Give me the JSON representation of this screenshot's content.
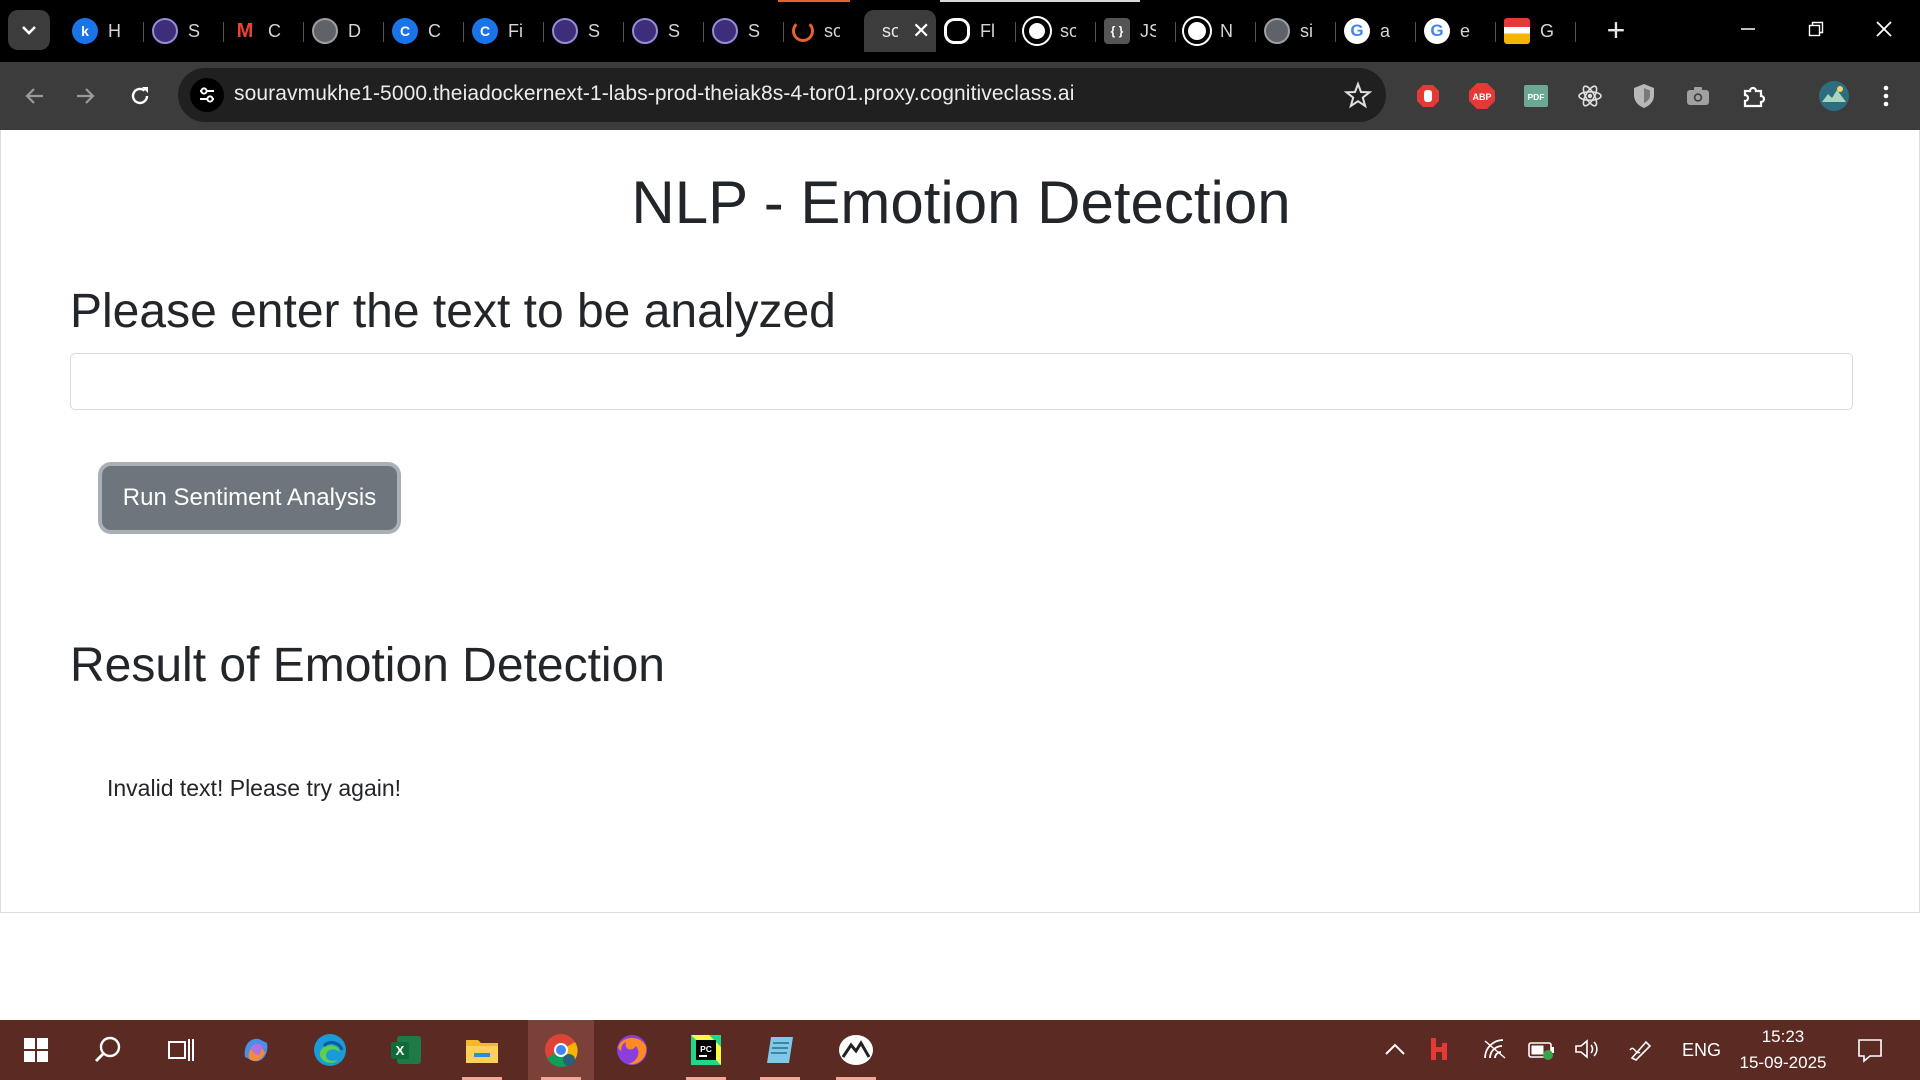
{
  "browser": {
    "tabs": [
      {
        "label": "H",
        "icon": "kaggle-icon",
        "color": "#1a73e8"
      },
      {
        "label": "S",
        "icon": "coursera-icon",
        "color": "#3d2d7a"
      },
      {
        "label": "C",
        "icon": "gmail-icon",
        "color": "#ea4335"
      },
      {
        "label": "D",
        "icon": "globe-icon",
        "color": "#5f6368"
      },
      {
        "label": "C",
        "icon": "c-icon",
        "color": "#1a73e8"
      },
      {
        "label": "Fi",
        "icon": "c-icon",
        "color": "#1a73e8"
      },
      {
        "label": "S",
        "icon": "coursera-icon",
        "color": "#3d2d7a"
      },
      {
        "label": "S",
        "icon": "coursera-icon",
        "color": "#3d2d7a"
      },
      {
        "label": "S",
        "icon": "coursera-icon",
        "color": "#3d2d7a"
      },
      {
        "label": "so",
        "icon": "loading-icon",
        "color": "#e8602c"
      },
      {
        "label": "so",
        "icon": "active-tab",
        "color": "#3c3c3c",
        "active": true
      },
      {
        "label": "Fl",
        "icon": "openai-icon",
        "color": "#ffffff"
      },
      {
        "label": "so",
        "icon": "github-icon",
        "color": "#ffffff"
      },
      {
        "label": "JS",
        "icon": "json-icon",
        "color": "#555555"
      },
      {
        "label": "N",
        "icon": "chrome-icon",
        "color": "#ffffff"
      },
      {
        "label": "si",
        "icon": "globe-icon",
        "color": "#5f6368"
      },
      {
        "label": "a",
        "icon": "google-icon",
        "color": "#ffffff"
      },
      {
        "label": "e",
        "icon": "google-icon",
        "color": "#ffffff"
      },
      {
        "label": "G",
        "icon": "gallery-icon",
        "color": "#e53935"
      }
    ],
    "url": "souravmukhe1-5000.theiadockernext-1-labs-prod-theiak8s-4-tor01.proxy.cognitiveclass.ai",
    "extensions": [
      "stop-hand-icon",
      "adblock-icon",
      "pdf-icon",
      "react-icon",
      "shield-icon",
      "camera-icon",
      "puzzle-icon",
      "profile-avatar"
    ]
  },
  "page": {
    "title": "NLP - Emotion Detection",
    "prompt": "Please enter the text to be analyzed",
    "input_value": "",
    "button_label": "Run Sentiment Analysis",
    "result_heading": "Result of Emotion Detection",
    "result_text": "Invalid text! Please try again!"
  },
  "taskbar": {
    "apps": [
      "start-icon",
      "search-icon",
      "task-view-icon",
      "copilot-icon",
      "edge-icon",
      "excel-icon",
      "file-explorer-icon",
      "chrome-icon",
      "firefox-icon",
      "pycharm-icon",
      "notepad-icon",
      "mobaxterm-icon"
    ],
    "language": "ENG",
    "time": "15:23",
    "date": "15-09-2025"
  },
  "colors": {
    "page_text": "#222529",
    "button_bg": "#6d757d",
    "taskbar_bg": "#5a2a23",
    "toolbar_bg": "#3c3c3c"
  }
}
